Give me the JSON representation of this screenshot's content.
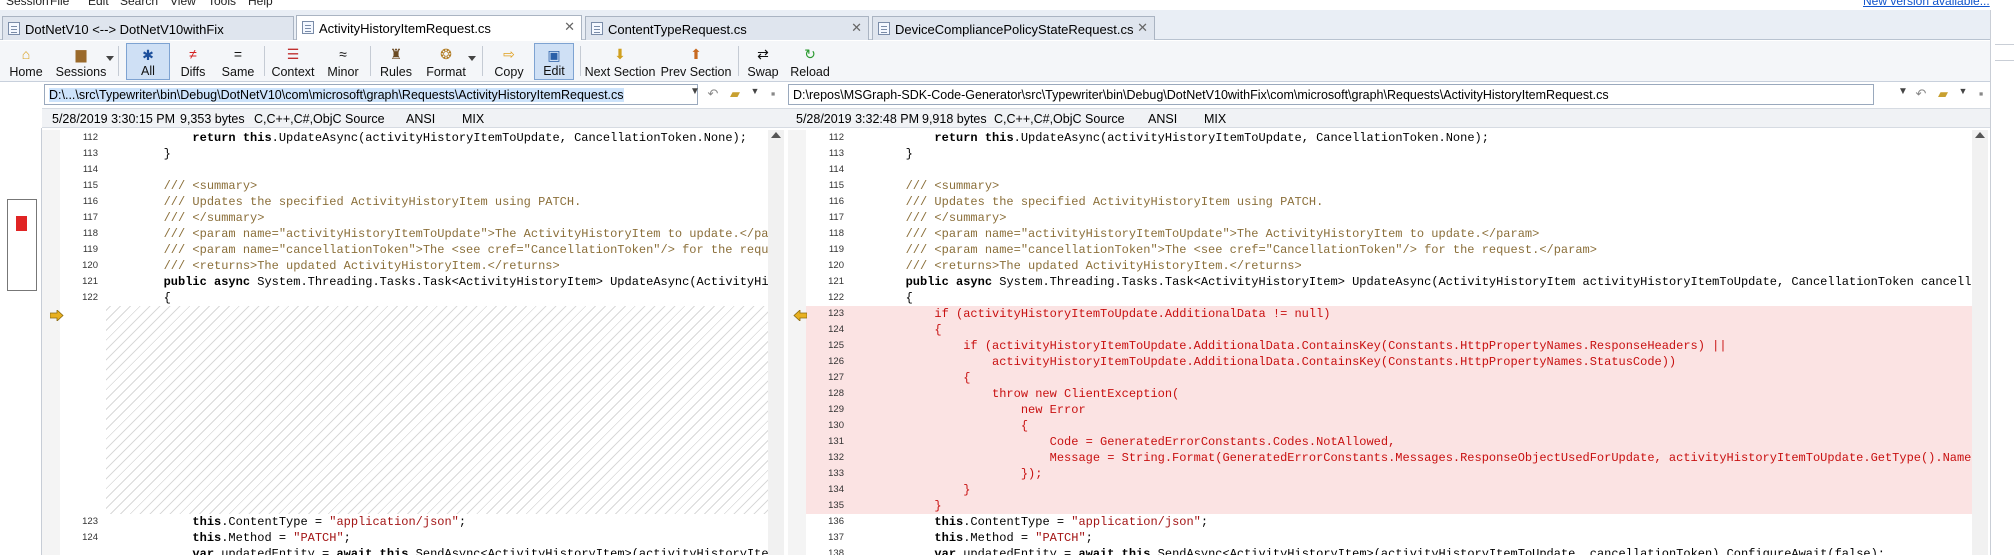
{
  "menu": {
    "items": [
      "Session",
      "File",
      "Edit",
      "Search",
      "View",
      "Tools",
      "Help"
    ],
    "new_version": "New version available..."
  },
  "tabs": [
    {
      "label": "DotNetV10 <--> DotNetV10withFix",
      "active": false,
      "closable": false
    },
    {
      "label": "ActivityHistoryItemRequest.cs",
      "active": true,
      "closable": true
    },
    {
      "label": "ContentTypeRequest.cs",
      "active": false,
      "closable": true
    },
    {
      "label": "DeviceCompliancePolicyStateRequest.cs",
      "active": false,
      "closable": true
    }
  ],
  "toolbar": {
    "home": "Home",
    "sessions": "Sessions",
    "all": "All",
    "diffs": "Diffs",
    "same": "Same",
    "context": "Context",
    "minor": "Minor",
    "rules": "Rules",
    "format": "Format",
    "copy": "Copy",
    "edit": "Edit",
    "next_section": "Next Section",
    "prev_section": "Prev Section",
    "swap": "Swap",
    "reload": "Reload"
  },
  "left": {
    "path_prefix": "D:\\...\\src\\Typewriter\\bin\\Debug\\DotNetV10\\com\\microsoft\\graph\\Requests\\ActivityHistoryItemRequest.cs",
    "date": "5/28/2019 3:30:15 PM",
    "size": "9,353 bytes",
    "format": "C,C++,C#,ObjC Source",
    "encoding": "ANSI",
    "eol": "MIX",
    "line_numbers": [
      "112",
      "113",
      "114",
      "115",
      "116",
      "117",
      "118",
      "119",
      "120",
      "121",
      "122",
      "",
      "",
      "",
      "",
      "",
      "",
      "",
      "",
      "",
      "",
      "",
      "",
      "",
      "123",
      "124"
    ]
  },
  "right": {
    "path": "D:\\repos\\MSGraph-SDK-Code-Generator\\src\\Typewriter\\bin\\Debug\\DotNetV10withFix\\com\\microsoft\\graph\\Requests\\ActivityHistoryItemRequest.cs",
    "date": "5/28/2019 3:32:48 PM",
    "size": "9,918 bytes",
    "format": "C,C++,C#,ObjC Source",
    "encoding": "ANSI",
    "eol": "MIX",
    "line_numbers": [
      "112",
      "113",
      "114",
      "115",
      "116",
      "117",
      "118",
      "119",
      "120",
      "121",
      "122",
      "123",
      "124",
      "125",
      "126",
      "127",
      "128",
      "129",
      "130",
      "131",
      "132",
      "133",
      "134",
      "135",
      "136",
      "137",
      "138"
    ]
  },
  "code_left": [
    "            return this.UpdateAsync(activityHistoryItemToUpdate, CancellationToken.None);",
    "        }",
    "",
    "        /// <summary>",
    "        /// Updates the specified ActivityHistoryItem using PATCH.",
    "        /// </summary>",
    "        /// <param name=\"activityHistoryItemToUpdate\">The ActivityHistoryItem to update.</param>",
    "        /// <param name=\"cancellationToken\">The <see cref=\"CancellationToken\"/> for the request.</param>",
    "        /// <returns>The updated ActivityHistoryItem.</returns>",
    "        public async System.Threading.Tasks.Task<ActivityHistoryItem> UpdateAsync(ActivityHistoryItem activityHistoryItemToUpdate, CancellationToken cancellationToken)",
    "        {",
    "            this.ContentType = \"application/json\";",
    "            this.Method = \"PATCH\";",
    "            var updatedEntity = await this.SendAsync<ActivityHistoryItem>(activityHistoryItemToUpdate, cancellationToken).ConfigureAwait(false);"
  ],
  "code_right": [
    "            return this.UpdateAsync(activityHistoryItemToUpdate, CancellationToken.None);",
    "        }",
    "",
    "        /// <summary>",
    "        /// Updates the specified ActivityHistoryItem using PATCH.",
    "        /// </summary>",
    "        /// <param name=\"activityHistoryItemToUpdate\">The ActivityHistoryItem to update.</param>",
    "        /// <param name=\"cancellationToken\">The <see cref=\"CancellationToken\"/> for the request.</param>",
    "        /// <returns>The updated ActivityHistoryItem.</returns>",
    "        public async System.Threading.Tasks.Task<ActivityHistoryItem> UpdateAsync(ActivityHistoryItem activityHistoryItemToUpdate, CancellationToken cancellationToken)",
    "        {",
    "            if (activityHistoryItemToUpdate.AdditionalData != null)",
    "            {",
    "                if (activityHistoryItemToUpdate.AdditionalData.ContainsKey(Constants.HttpPropertyNames.ResponseHeaders) ||",
    "                    activityHistoryItemToUpdate.AdditionalData.ContainsKey(Constants.HttpPropertyNames.StatusCode))",
    "                {",
    "                    throw new ClientException(",
    "                        new Error",
    "                        {",
    "                            Code = GeneratedErrorConstants.Codes.NotAllowed,",
    "                            Message = String.Format(GeneratedErrorConstants.Messages.ResponseObjectUsedForUpdate, activityHistoryItemToUpdate.GetType().Name)",
    "                        });",
    "                }",
    "            }",
    "            this.ContentType = \"application/json\";",
    "            this.Method = \"PATCH\";",
    "            var updatedEntity = await this.SendAsync<ActivityHistoryItem>(activityHistoryItemToUpdate, cancellationToken).ConfigureAwait(false);"
  ],
  "colors": {
    "diff_text": "#c81010",
    "diff_band": "#fbe3e3",
    "comment": "#8b6f3a",
    "string": "#a31515"
  }
}
